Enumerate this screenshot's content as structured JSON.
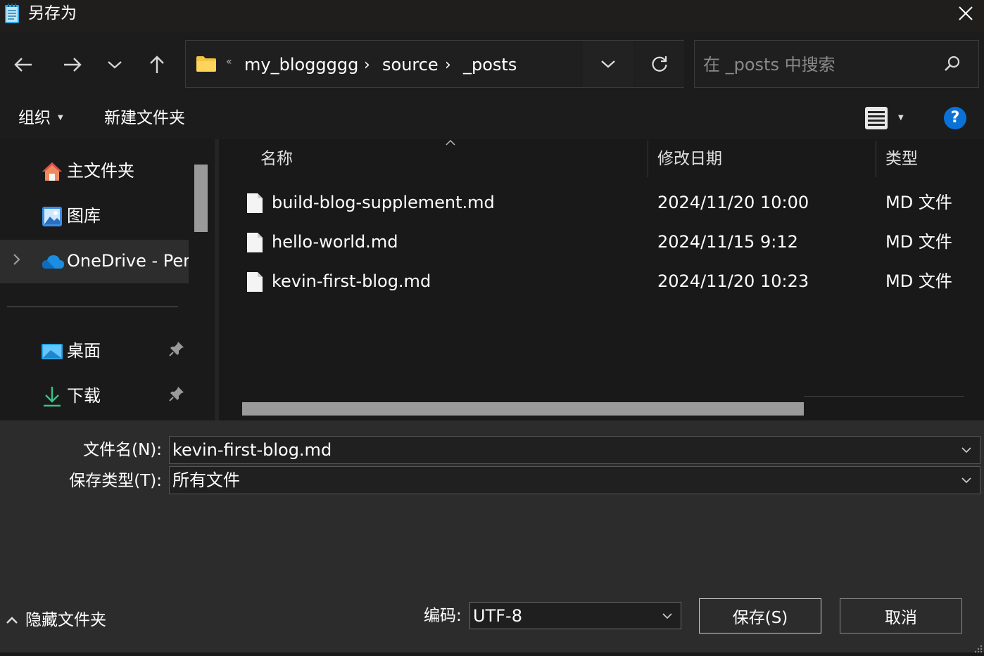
{
  "window": {
    "title": "另存为"
  },
  "address": {
    "overflow": "«",
    "crumbs": [
      "my_bloggggg",
      "source",
      "_posts"
    ]
  },
  "search": {
    "placeholder": "在 _posts 中搜索"
  },
  "toolbar": {
    "organize": "组织",
    "new_folder": "新建文件夹",
    "help": "?"
  },
  "nav": {
    "items": [
      {
        "label": "主文件夹",
        "icon": "home-icon"
      },
      {
        "label": "图库",
        "icon": "gallery-icon"
      },
      {
        "label": "OneDrive - Per",
        "icon": "onedrive-icon"
      },
      {
        "label": "桌面",
        "icon": "desktop-icon"
      },
      {
        "label": "下载",
        "icon": "download-icon"
      }
    ]
  },
  "columns": {
    "name": "名称",
    "modified": "修改日期",
    "type": "类型"
  },
  "files": [
    {
      "name": "build-blog-supplement.md",
      "modified": "2024/11/20 10:00",
      "type": "MD 文件"
    },
    {
      "name": "hello-world.md",
      "modified": "2024/11/15 9:12",
      "type": "MD 文件"
    },
    {
      "name": "kevin-first-blog.md",
      "modified": "2024/11/20 10:23",
      "type": "MD 文件"
    }
  ],
  "form": {
    "filename_label": "文件名(N):",
    "filename_value": "kevin-first-blog.md",
    "filetype_label": "保存类型(T):",
    "filetype_value": "所有文件"
  },
  "footer": {
    "hide_folders": "隐藏文件夹",
    "encoding_label": "编码:",
    "encoding_value": "UTF-8",
    "save": "保存(S)",
    "cancel": "取消"
  },
  "colors": {
    "accent": "#0a72d6",
    "folder": "#f5c542",
    "background": "#191919"
  }
}
